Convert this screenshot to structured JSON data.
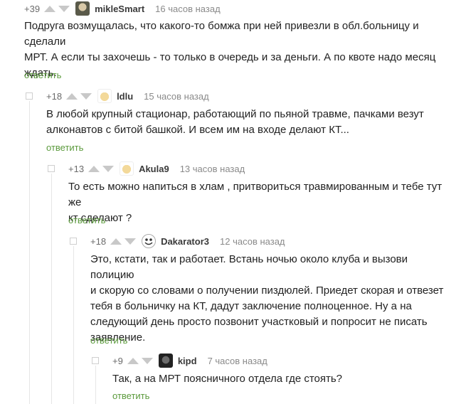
{
  "comments": [
    {
      "rating": "+39",
      "username": "mikleSmart",
      "time": "16 часов назад",
      "avatar": "avatar-photo-icon",
      "lines": [
        "Подруга возмущалась, что какого-то бомжа при ней привезли в обл.больницу и сделали",
        "МРТ. А если ты захочешь - то только в очередь и за деньги. А по квоте надо месяц",
        "ждать."
      ],
      "reply": "ответить"
    },
    {
      "rating": "+18",
      "username": "ldlu",
      "time": "15 часов назад",
      "avatar": "avatar-cartoon-icon",
      "lines": [
        "В любой крупный стационар, работающий по пьяной травме, пачками везут",
        "алконавтов с битой башкой. И всем им на входе делают КТ..."
      ],
      "reply": "ответить"
    },
    {
      "rating": "+13",
      "username": "Akula9",
      "time": "13 часов назад",
      "avatar": "avatar-cartoon-icon",
      "lines": [
        "То есть можно напиться в хлам , притвориться травмированным и тебе тут же",
        "кт сделают ?"
      ],
      "reply": "ответить"
    },
    {
      "rating": "+18",
      "username": "Dakarator3",
      "time": "12 часов назад",
      "avatar": "avatar-troll-face-icon",
      "lines": [
        "Это, кстати, так и работает. Встань ночью около клуба и вызови полицию",
        "и скорую со словами о получении пиздюлей. Приедет скорая и отвезет",
        "тебя в больничку на КТ, дадут заключение полноценное. Ну а на",
        "следующий день просто позвонит участковый и попросит не писать",
        "заявление."
      ],
      "reply": "ответить"
    },
    {
      "rating": "+9",
      "username": "kipd",
      "time": "7 часов назад",
      "avatar": "avatar-photo-icon",
      "lines": [
        "Так, а на МРТ поясничного отдела где стоять?"
      ],
      "reply": "ответить"
    }
  ]
}
